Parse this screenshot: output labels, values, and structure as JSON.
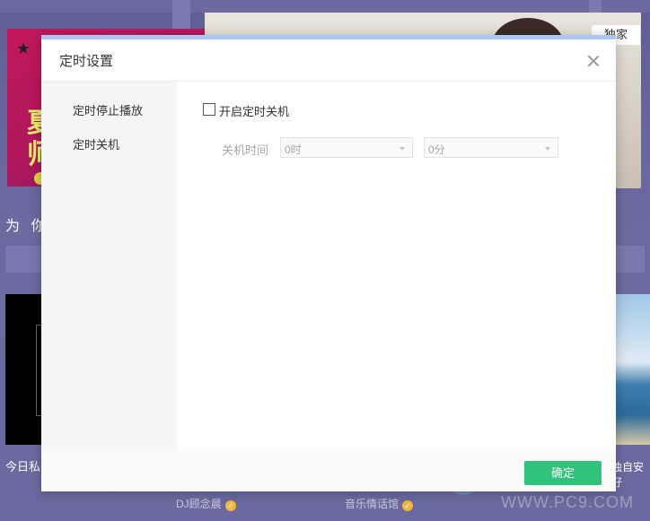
{
  "background": {
    "exclusive_badge": "独家",
    "section_title": "为 你",
    "card_caption_left": "今日私",
    "card_caption_right": "独自安好",
    "footer_items": [
      "DJ顾念晨",
      "音乐情话馆"
    ],
    "watermark": "WWW.PC9.COM"
  },
  "dialog": {
    "title": "定时设置",
    "nav": [
      {
        "label": "定时停止播放"
      },
      {
        "label": "定时关机"
      }
    ],
    "shutdown": {
      "checkbox_label": "开启定时关机",
      "checked": false,
      "time_label": "关机时间",
      "hour_value": "0时",
      "minute_value": "0分"
    },
    "confirm_label": "确定"
  },
  "colors": {
    "accent_green": "#31c27c",
    "top_bar": "#a9c7ef"
  }
}
